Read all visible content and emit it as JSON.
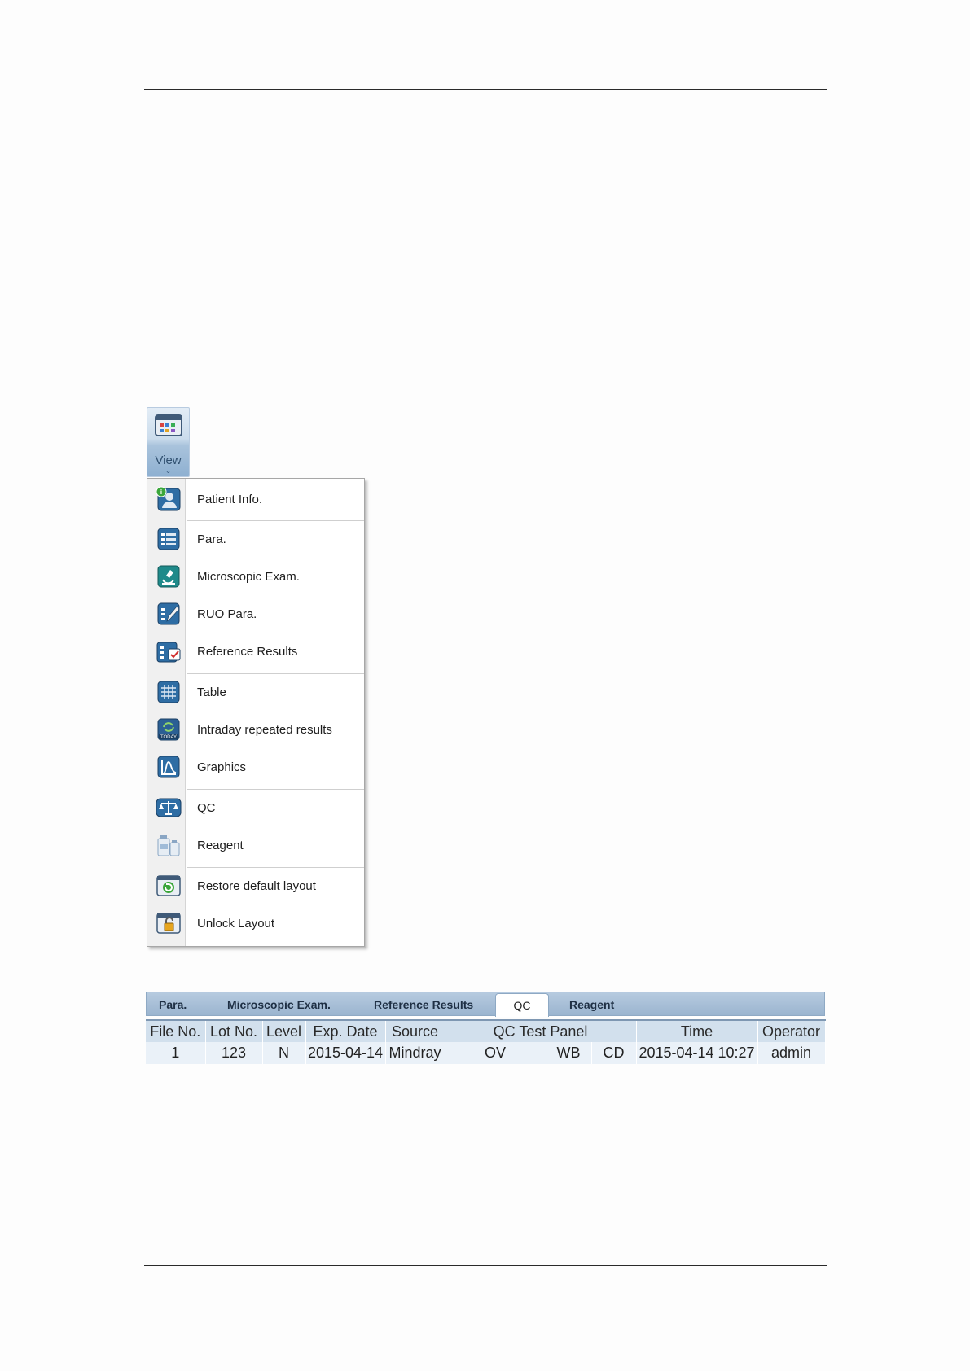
{
  "view_button": {
    "label": "View"
  },
  "menu": {
    "items": [
      {
        "label": "Patient Info.",
        "icon": "patient-info-icon"
      },
      {
        "label": "Para.",
        "icon": "para-icon"
      },
      {
        "label": "Microscopic Exam.",
        "icon": "microscope-icon"
      },
      {
        "label": "RUO Para.",
        "icon": "ruo-para-icon"
      },
      {
        "label": "Reference Results",
        "icon": "reference-results-icon"
      },
      {
        "label": "Table",
        "icon": "table-grid-icon"
      },
      {
        "label": "Intraday repeated results",
        "icon": "today-refresh-icon"
      },
      {
        "label": "Graphics",
        "icon": "graphics-icon"
      },
      {
        "label": "QC",
        "icon": "balance-scale-icon"
      },
      {
        "label": "Reagent",
        "icon": "reagent-bottles-icon"
      },
      {
        "label": "Restore default layout",
        "icon": "restore-layout-icon"
      },
      {
        "label": "Unlock Layout",
        "icon": "unlock-layout-icon"
      }
    ]
  },
  "tabs": {
    "items": [
      "Para.",
      "Microscopic Exam.",
      "Reference Results",
      "QC",
      "Reagent"
    ],
    "active": "QC"
  },
  "qc_table": {
    "headers": [
      "File No.",
      "Lot No.",
      "Level",
      "Exp. Date",
      "Source",
      "QC Test Panel",
      "Time",
      "Operator"
    ],
    "row": {
      "file_no": "1",
      "lot_no": "123",
      "level": "N",
      "exp_date": "2015-04-14",
      "source": "Mindray",
      "panel_1": "OV",
      "panel_2": "WB",
      "panel_3": "CD",
      "time": "2015-04-14 10:27",
      "operator": "admin"
    }
  },
  "colors": {
    "menu_gutter": "#f0f0f0",
    "tab_bar": "#a9c0d8",
    "table_header": "#d2e0ed",
    "table_row": "#eaf1f8"
  }
}
